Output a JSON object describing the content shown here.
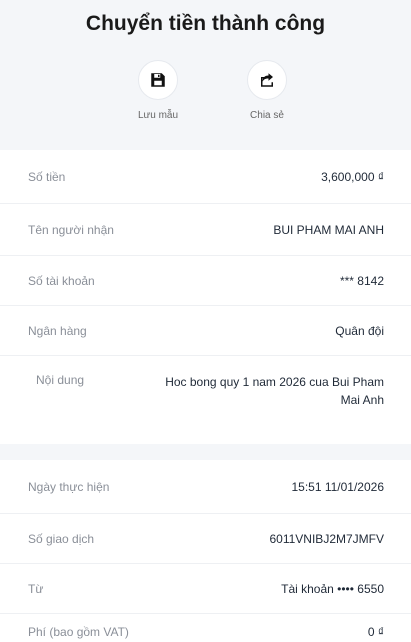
{
  "title": "Chuyển tiền thành công",
  "actions": [
    {
      "label": "Lưu mẫu",
      "icon": "save-icon"
    },
    {
      "label": "Chia sẻ",
      "icon": "share-icon"
    }
  ],
  "details": [
    {
      "label": "Số tiền",
      "value": "3,600,000 ₫"
    },
    {
      "label": "Tên người nhận",
      "value": "BUI PHAM MAI ANH"
    },
    {
      "label": "Số tài khoản",
      "value": "*** 8142"
    },
    {
      "label": "Ngân hàng",
      "value": "Quân đội"
    },
    {
      "label": "Nội dung",
      "value": "Hoc bong quy 1 nam 2026 cua Bui Pham Mai Anh"
    }
  ],
  "details2": [
    {
      "label": "Ngày thực hiện",
      "value": "15:51 11/01/2026"
    },
    {
      "label": "Số giao dịch",
      "value": "6011VNIBJ2M7JMFV"
    },
    {
      "label": "Từ",
      "value": "Tài khoản •••• 6550"
    },
    {
      "label": "Phí (bao gồm VAT)",
      "value": "0 ₫"
    }
  ]
}
